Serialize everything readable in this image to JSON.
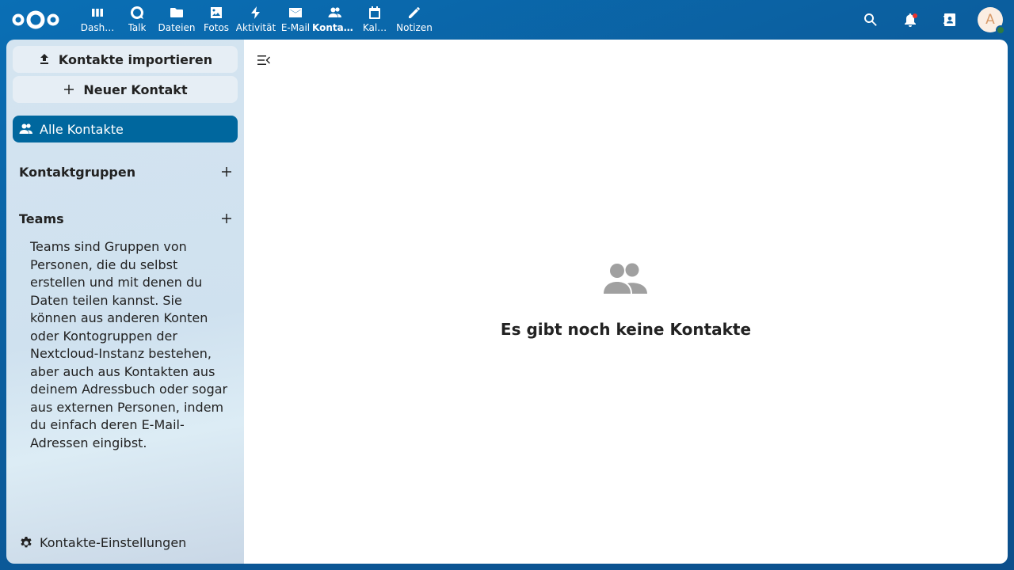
{
  "header": {
    "apps": [
      {
        "label": "Dash…",
        "icon": "dashboard-icon",
        "active": false
      },
      {
        "label": "Talk",
        "icon": "talk-icon",
        "active": false
      },
      {
        "label": "Dateien",
        "icon": "folder-icon",
        "active": false
      },
      {
        "label": "Fotos",
        "icon": "image-icon",
        "active": false
      },
      {
        "label": "Aktivität",
        "icon": "lightning-icon",
        "active": false
      },
      {
        "label": "E-Mail",
        "icon": "mail-icon",
        "active": false
      },
      {
        "label": "Kontakte",
        "icon": "contacts-icon",
        "active": true
      },
      {
        "label": "Kal…",
        "icon": "calendar-icon",
        "active": false
      },
      {
        "label": "Notizen",
        "icon": "pencil-icon",
        "active": false
      }
    ],
    "avatar_initial": "A"
  },
  "sidebar": {
    "import_label": "Kontakte importieren",
    "new_contact_label": "Neuer Kontakt",
    "all_contacts_label": "Alle Kontakte",
    "groups_heading": "Kontaktgruppen",
    "teams_heading": "Teams",
    "teams_description": "Teams sind Gruppen von Personen, die du selbst erstellen und mit denen du Daten teilen kannst. Sie können aus anderen Konten oder Kontogruppen der Nextcloud-Instanz bestehen, aber auch aus Kontakten aus deinem Adressbuch oder sogar aus externen Personen, indem du einfach deren E-Mail-Adressen eingibst.",
    "settings_label": "Kontakte-Einstellungen"
  },
  "main": {
    "empty_title": "Es gibt noch keine Kontakte"
  },
  "colors": {
    "header_bg": "#0b5e9e",
    "active_nav": "#00679e",
    "notification_dot": "#e9322d",
    "status_online": "#2d7b41"
  }
}
